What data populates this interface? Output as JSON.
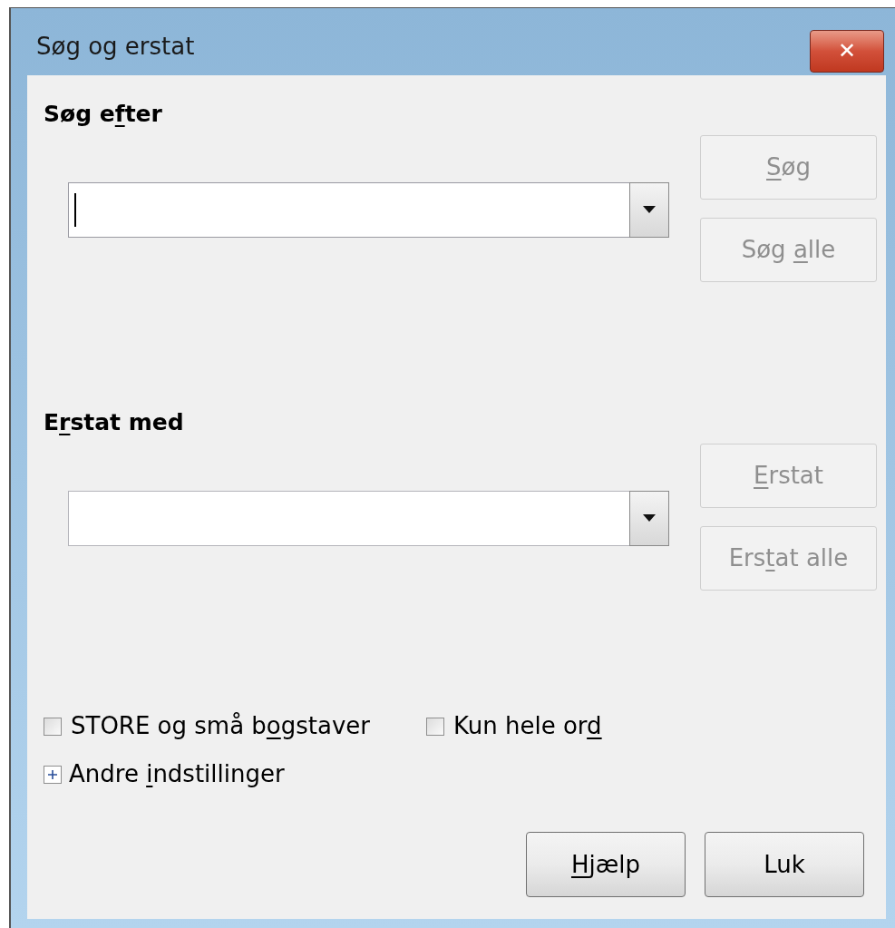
{
  "window": {
    "title": "Søg og erstat",
    "close": "✕"
  },
  "sections": [
    {
      "label": {
        "before": "Søg e",
        "key": "f",
        "after": "ter"
      },
      "field": {
        "focused": true
      },
      "buttons": [
        {
          "label": {
            "key": "S",
            "after": "øg"
          },
          "disabled": true
        },
        {
          "label": {
            "before": "Søg ",
            "key": "a",
            "after": "lle"
          },
          "disabled": true
        }
      ]
    },
    {
      "label": {
        "before": "E",
        "key": "r",
        "after": "stat med"
      },
      "field": {
        "focused": false
      },
      "buttons": [
        {
          "label": {
            "key": "E",
            "after": "rstat"
          },
          "disabled": true
        },
        {
          "label": {
            "before": "Ers",
            "key": "t",
            "after": "at alle"
          },
          "disabled": true
        }
      ]
    }
  ],
  "options": [
    {
      "label": {
        "before": "STORE og små b",
        "key": "o",
        "after": "gstaver"
      },
      "checked": false
    },
    {
      "label": {
        "before": "Kun hele or",
        "key": "d"
      },
      "checked": false
    }
  ],
  "expander": {
    "label": {
      "before": "Andre ",
      "key": "i",
      "after": "ndstillinger"
    },
    "expanded": false
  },
  "footer_buttons": [
    {
      "label": {
        "key": "H",
        "after": "jælp"
      }
    },
    {
      "label": {
        "before": "Luk"
      }
    }
  ]
}
